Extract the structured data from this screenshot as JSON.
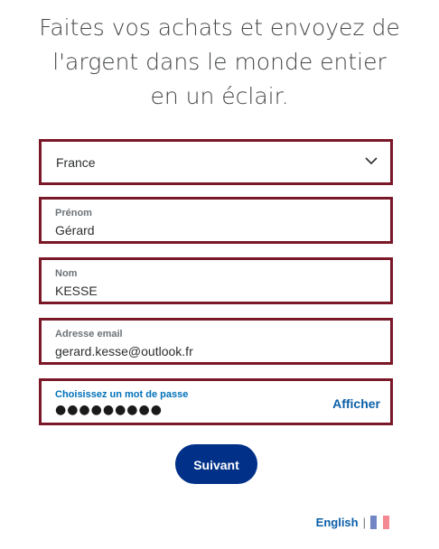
{
  "header": {
    "headline": "Faites vos achats et envoyez de l'argent dans le monde entier en un éclair."
  },
  "form": {
    "country": {
      "value": "France",
      "icon": "chevron-down-icon"
    },
    "first_name": {
      "label": "Prénom",
      "value": "Gérard"
    },
    "last_name": {
      "label": "Nom",
      "value": "KESSE"
    },
    "email": {
      "label": "Adresse email",
      "value": "gerard.kesse@outlook.fr"
    },
    "password": {
      "label": "Choisissez un mot de passe",
      "masked_value": "●●●●●●●●●",
      "show_label": "Afficher"
    },
    "submit_label": "Suivant"
  },
  "footer": {
    "language_link": "English",
    "separator": "|",
    "flag_icon": "france-flag-icon"
  },
  "colors": {
    "field_border": "#7a1828",
    "primary_button": "#003087",
    "link": "#0b5fa8",
    "label_focus": "#0070ba"
  }
}
